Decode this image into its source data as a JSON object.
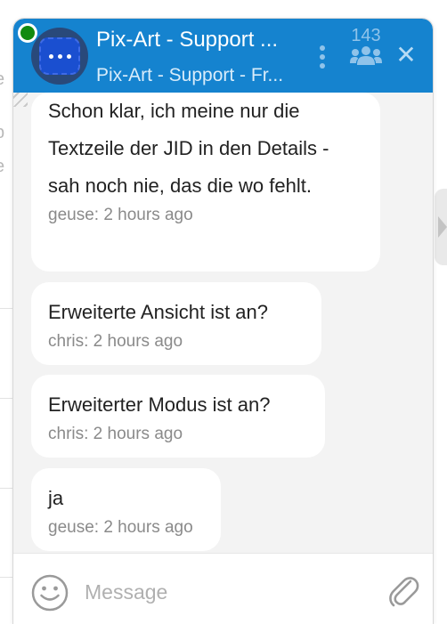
{
  "background": {
    "fragments": [
      "e",
      "b",
      "e"
    ]
  },
  "header": {
    "title": "Pix-Art - Support ...",
    "subtitle": "Pix-Art - Support - Fr...",
    "occupant_count": "143",
    "close_glyph": "✕"
  },
  "messages": [
    {
      "text": "Schon klar, ich meine nur die Textzeile der JID in den Details - sah noch nie, das die wo fehlt.",
      "meta": "geuse: 2 hours ago"
    },
    {
      "text": "Erweiterte Ansicht ist an?",
      "meta": "chris: 2 hours ago"
    },
    {
      "text": "Erweiterter Modus ist an?",
      "meta": "chris: 2 hours ago"
    },
    {
      "text": "ja",
      "meta": "geuse: 2 hours ago"
    }
  ],
  "composer": {
    "placeholder": "Message"
  },
  "colors": {
    "header": "#1583cf",
    "status_online": "#118a0f",
    "chat_background": "#f3f3f3",
    "bubble": "#ffffff"
  },
  "icons": {
    "status": "online-status-icon",
    "menu": "kebab-menu-icon",
    "occupants": "group-people-icon",
    "close": "close-icon",
    "emoji": "smiley-icon",
    "attach": "paperclip-icon"
  }
}
